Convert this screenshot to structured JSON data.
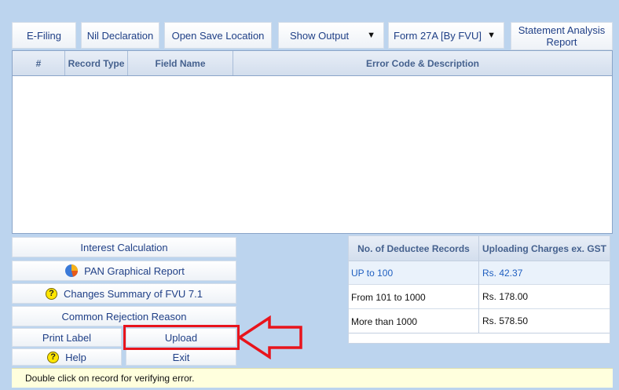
{
  "toolbar": {
    "efiling": "E-Filing",
    "nil_declaration": "Nil Declaration",
    "open_save_location": "Open Save Location",
    "show_output": "Show Output",
    "form_select": "Form 27A [By FVU]",
    "statement_analysis_line1": "Statement Analysis",
    "statement_analysis_line2": "Report",
    "caret": "▼"
  },
  "grid": {
    "columns": [
      "#",
      "Record Type",
      "Field Name",
      "Error Code & Description"
    ],
    "rows": []
  },
  "side_buttons": {
    "interest_calculation": "Interest Calculation",
    "pan_graphical_report": "PAN Graphical Report",
    "changes_summary": "Changes Summary of FVU 7.1",
    "common_rejection": "Common Rejection Reason",
    "print_label": "Print Label",
    "upload": "Upload",
    "help": "Help",
    "exit": "Exit"
  },
  "charges_table": {
    "headers": [
      "No. of Deductee Records",
      "Uploading Charges ex. GST"
    ],
    "rows": [
      {
        "range": "UP to 100",
        "charge": "Rs. 42.37"
      },
      {
        "range": "From 101 to 1000",
        "charge": "Rs. 178.00"
      },
      {
        "range": "More than 1000",
        "charge": "Rs. 578.50"
      }
    ]
  },
  "status": {
    "message": "Double click on record for verifying error."
  },
  "colors": {
    "background": "#bcd4ee",
    "highlight": "#e8141c",
    "link_blue": "#1f5fc0"
  }
}
